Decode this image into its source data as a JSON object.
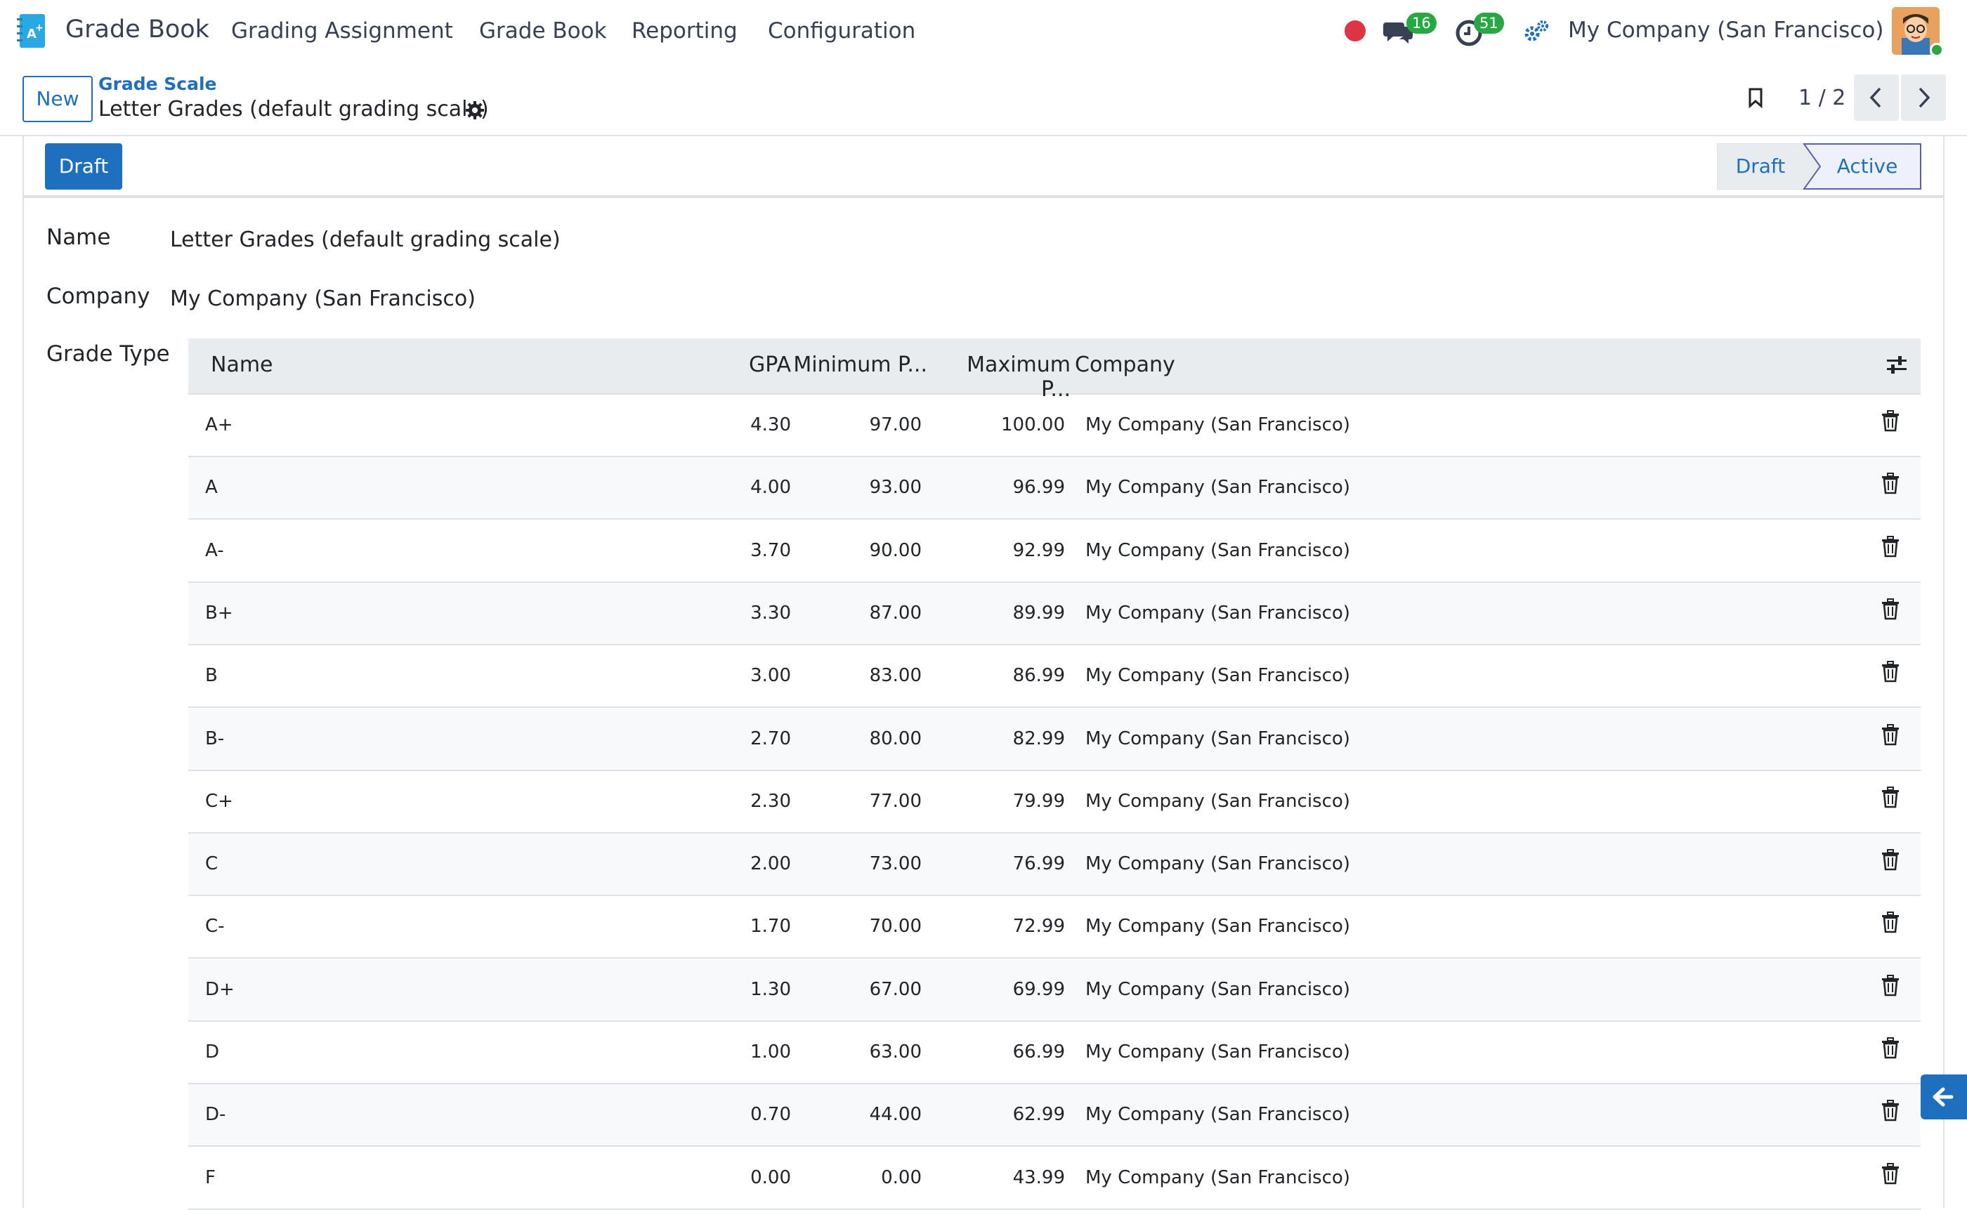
{
  "navbar": {
    "app_name": "Grade Book",
    "menu": [
      "Grading Assignment",
      "Grade Book",
      "Reporting",
      "Configuration"
    ],
    "messages_count": "16",
    "activities_count": "51",
    "company": "My Company (San Francisco)"
  },
  "control_panel": {
    "new_label": "New",
    "breadcrumb_parent": "Grade Scale",
    "breadcrumb_current": "Letter Grades (default grading scale)",
    "pager": "1 / 2"
  },
  "statusbar": {
    "draft_button": "Draft",
    "stages": [
      "Draft",
      "Active"
    ],
    "active_stage": "Active"
  },
  "form": {
    "name_label": "Name",
    "name_value": "Letter Grades (default grading scale)",
    "company_label": "Company",
    "company_value": "My Company (San Francisco)",
    "grade_type_label": "Grade Type"
  },
  "table": {
    "headers": [
      "Name",
      "GPA",
      "Minimum P...",
      "Maximum P...",
      "Company"
    ],
    "rows": [
      {
        "name": "A+",
        "gpa": "4.30",
        "min": "97.00",
        "max": "100.00",
        "company": "My Company (San Francisco)"
      },
      {
        "name": "A",
        "gpa": "4.00",
        "min": "93.00",
        "max": "96.99",
        "company": "My Company (San Francisco)"
      },
      {
        "name": "A-",
        "gpa": "3.70",
        "min": "90.00",
        "max": "92.99",
        "company": "My Company (San Francisco)"
      },
      {
        "name": "B+",
        "gpa": "3.30",
        "min": "87.00",
        "max": "89.99",
        "company": "My Company (San Francisco)"
      },
      {
        "name": "B",
        "gpa": "3.00",
        "min": "83.00",
        "max": "86.99",
        "company": "My Company (San Francisco)"
      },
      {
        "name": "B-",
        "gpa": "2.70",
        "min": "80.00",
        "max": "82.99",
        "company": "My Company (San Francisco)"
      },
      {
        "name": "C+",
        "gpa": "2.30",
        "min": "77.00",
        "max": "79.99",
        "company": "My Company (San Francisco)"
      },
      {
        "name": "C",
        "gpa": "2.00",
        "min": "73.00",
        "max": "76.99",
        "company": "My Company (San Francisco)"
      },
      {
        "name": "C-",
        "gpa": "1.70",
        "min": "70.00",
        "max": "72.99",
        "company": "My Company (San Francisco)"
      },
      {
        "name": "D+",
        "gpa": "1.30",
        "min": "67.00",
        "max": "69.99",
        "company": "My Company (San Francisco)"
      },
      {
        "name": "D",
        "gpa": "1.00",
        "min": "63.00",
        "max": "66.99",
        "company": "My Company (San Francisco)"
      },
      {
        "name": "D-",
        "gpa": "0.70",
        "min": "44.00",
        "max": "62.99",
        "company": "My Company (San Francisco)"
      },
      {
        "name": "F",
        "gpa": "0.00",
        "min": "0.00",
        "max": "43.99",
        "company": "My Company (San Francisco)"
      }
    ]
  },
  "colors": {
    "primary": "#1f6fbf",
    "badge_green": "#28a745",
    "record_red": "#dc3545"
  }
}
